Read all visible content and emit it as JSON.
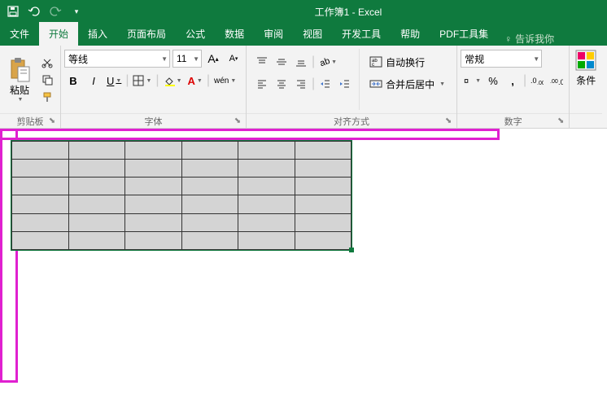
{
  "title": "工作簿1 - Excel",
  "tabs": {
    "file": "文件",
    "home": "开始",
    "insert": "插入",
    "layout": "页面布局",
    "formula": "公式",
    "data": "数据",
    "review": "审阅",
    "view": "视图",
    "dev": "开发工具",
    "help": "帮助",
    "pdf": "PDF工具集"
  },
  "tellme": "告诉我你",
  "clipboard": {
    "label": "剪贴板",
    "paste": "粘贴"
  },
  "font": {
    "label": "字体",
    "name": "等线",
    "size": "11",
    "bold": "B",
    "italic": "I",
    "underline": "U",
    "wen": "wén"
  },
  "align": {
    "label": "对齐方式",
    "wrap": "自动换行",
    "merge": "合并后居中"
  },
  "number": {
    "label": "数字",
    "format": "常规",
    "percent": "%"
  },
  "styles": {
    "cond": "条件"
  }
}
